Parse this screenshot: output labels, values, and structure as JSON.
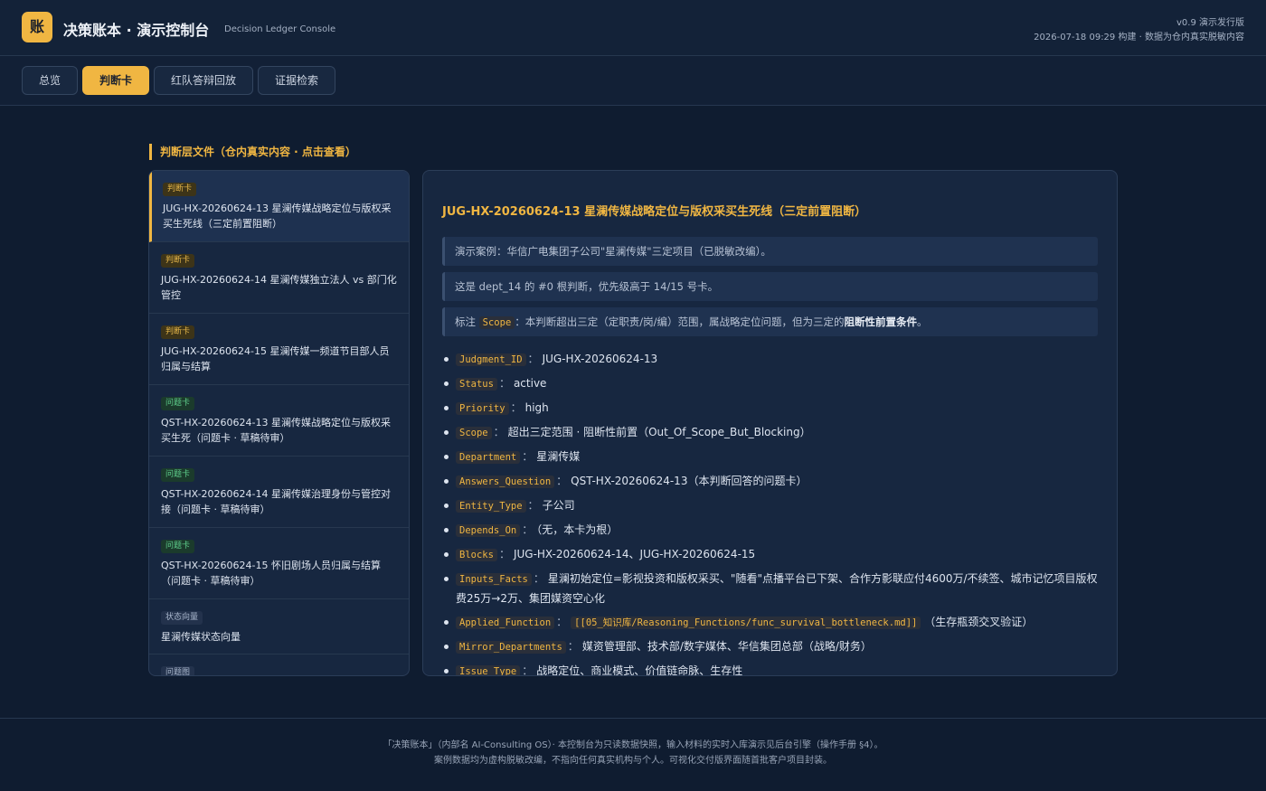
{
  "header": {
    "logo_char": "账",
    "title": "决策账本 · 演示控制台",
    "subtitle": "Decision Ledger Console",
    "version": "v0.9 演示发行版",
    "build_info": "2026-07-18 09:29 构建 · 数据为仓内真实脱敏内容"
  },
  "tabs": [
    "总览",
    "判断卡",
    "红队答辩回放",
    "证据检索"
  ],
  "active_tab": "判断卡",
  "section_title": "判断层文件（仓内真实内容 · 点击查看）",
  "list": [
    {
      "badge": "判断卡",
      "title": "JUG-HX-20260624-13 星澜传媒战略定位与版权采买生死线（三定前置阻断）"
    },
    {
      "badge": "判断卡",
      "title": "JUG-HX-20260624-14 星澜传媒独立法人 vs 部门化管控"
    },
    {
      "badge": "判断卡",
      "title": "JUG-HX-20260624-15 星澜传媒一频道节目部人员归属与结算"
    },
    {
      "badge": "问题卡",
      "title": "QST-HX-20260624-13 星澜传媒战略定位与版权采买生死（问题卡 · 草稿待审）"
    },
    {
      "badge": "问题卡",
      "title": "QST-HX-20260624-14 星澜传媒治理身份与管控对接（问题卡 · 草稿待审）"
    },
    {
      "badge": "问题卡",
      "title": "QST-HX-20260624-15 怀旧剧场人员归属与结算（问题卡 · 草稿待审）"
    },
    {
      "badge": "状态向量",
      "title": "星澜传媒状态向量"
    },
    {
      "badge": "问题图",
      "title": ""
    }
  ],
  "detail": {
    "title": "JUG-HX-20260624-13 星澜传媒战略定位与版权采买生死线（三定前置阻断）",
    "callout1": "演示案例：华信广电集团子公司\"星澜传媒\"三定项目（已脱敏改编）。",
    "callout2": "这是 dept_14 的 #0 根判断，优先级高于 14/15 号卡。",
    "callout3_prefix": "标注",
    "callout3_kw": "Scope",
    "callout3_text": "：本判断超出三定（定职责/岗/编）范围，属战略定位问题，但为三定的",
    "callout3_bold": "阻断性前置条件",
    "callout3_end": "。",
    "fields": [
      {
        "key": "Judgment_ID",
        "value": "JUG-HX-20260624-13"
      },
      {
        "key": "Status",
        "value": "active"
      },
      {
        "key": "Priority",
        "value": "high"
      },
      {
        "key": "Scope",
        "value": "超出三定范围 · 阻断性前置（Out_Of_Scope_But_Blocking）"
      },
      {
        "key": "Department",
        "value": "星澜传媒"
      },
      {
        "key": "Answers_Question",
        "value": "QST-HX-20260624-13（本判断回答的问题卡）"
      },
      {
        "key": "Entity_Type",
        "value": "子公司"
      },
      {
        "key": "Depends_On",
        "value": "（无，本卡为根）"
      },
      {
        "key": "Blocks",
        "value": "JUG-HX-20260624-14、JUG-HX-20260624-15"
      },
      {
        "key": "Inputs_Facts",
        "value": "星澜初始定位=影视投资和版权采买、\"随看\"点播平台已下架、合作方影联应付4600万/不续签、城市记忆项目版权费25万→2万、集团媒资空心化"
      },
      {
        "key": "Applied_Function",
        "value": "（生存瓶颈交叉验证）",
        "code": "[[05_知识库/Reasoning_Functions/func_survival_bottleneck.md]]"
      },
      {
        "key": "Mirror_Departments",
        "value": "媒资管理部、技术部/数字媒体、华信集团总部（战略/财务）"
      },
      {
        "key": "Issue_Type",
        "value": "战略定位、商业模式、价值链命脉、生存性"
      }
    ]
  },
  "footer": {
    "line1": "「决策账本」（内部名 AI-Consulting OS）· 本控制台为只读数据快照，输入材料的实时入库演示见后台引擎（操作手册 §4）。",
    "line2": "案例数据均为虚构脱敏改编，不指向任何真实机构与个人。可视化交付版界面随首批客户项目封装。"
  }
}
